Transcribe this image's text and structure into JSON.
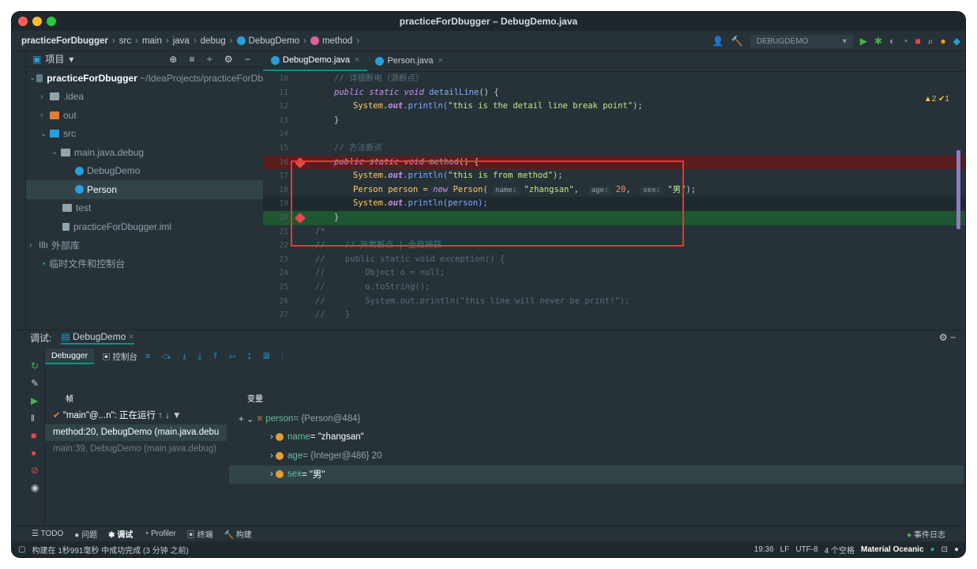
{
  "window_title": "practiceForDbugger – DebugDemo.java",
  "breadcrumb": [
    "practiceForDbugger",
    "src",
    "main",
    "java",
    "debug",
    "DebugDemo",
    "method"
  ],
  "run_config": "DEBUGDEMO",
  "project": {
    "header": "项目",
    "root_name": "practiceForDbugger",
    "root_path": "~/IdeaProjects/practiceForDb",
    "items": [
      {
        "label": ".idea"
      },
      {
        "label": "out"
      },
      {
        "label": "src"
      },
      {
        "label": "main.java.debug"
      },
      {
        "label": "DebugDemo"
      },
      {
        "label": "Person"
      },
      {
        "label": "test"
      },
      {
        "label": "practiceForDbugger.iml"
      },
      {
        "label": "外部库"
      },
      {
        "label": "临时文件和控制台"
      }
    ]
  },
  "editor": {
    "tabs": [
      {
        "label": "DebugDemo.java"
      },
      {
        "label": "Person.java"
      }
    ],
    "inspections": "▲2 ✔1",
    "line_numbers": [
      "10",
      "11",
      "12",
      "13",
      "14",
      "15",
      "16",
      "17",
      "18",
      "19",
      "20",
      "21",
      "22",
      "23",
      "24",
      "25",
      "26",
      "27"
    ],
    "code": {
      "l10": "// 详细断电（源断点）",
      "l11_kw": "public static void ",
      "l11_fn": "detailLine",
      "l11_rest": "() {",
      "l12_a": "System.",
      "l12_b": "out",
      "l12_c": ".println(",
      "l12_s": "\"this is the detail line break point\"",
      "l12_e": ");",
      "l13": "}",
      "l15": "// 方法断点",
      "l16_kw": "public static void ",
      "l16_fn": "method",
      "l16_rest": "() {",
      "l17_a": "System.",
      "l17_b": "out",
      "l17_c": ".println(",
      "l17_s": "\"this is from method\"",
      "l17_e": ");",
      "l18_a": "Person person = ",
      "l18_new": "new ",
      "l18_b": "Person( ",
      "l18_h1": "name:",
      "l18_s1": "\"zhangsan\"",
      "l18_c": ",  ",
      "l18_h2": "age:",
      "l18_n": "20",
      "l18_d": ",  ",
      "l18_h3": "sex:",
      "l18_s2": "\"男\"",
      "l18_e": ");",
      "l19_a": "System.",
      "l19_b": "out",
      "l19_c": ".println(person);",
      "l20": "}",
      "l21": "/*",
      "l22": "//    // 异常断点 | 全局捕获",
      "l23": "//    public static void exception() {",
      "l24": "//        Object o = null;",
      "l25": "//        o.toString();",
      "l26": "//        System.out.println(\"this line will never be print!\");",
      "l27": "//    }"
    }
  },
  "debug": {
    "title": "调试:",
    "config_tab": "DebugDemo",
    "debugger_tab": "Debugger",
    "console_tab": "控制台",
    "frames_header": "帧",
    "vars_header": "变量",
    "thread": "\"main\"@...n\": 正在运行",
    "frames": [
      "method:20, DebugDemo (main.java.debu",
      "main:39, DebugDemo (main.java.debug)"
    ],
    "vars": [
      {
        "name": "person",
        "value": " = {Person@484}"
      },
      {
        "name": "name",
        "value": " = \"zhangsan\""
      },
      {
        "name": "age",
        "value": " = {Integer@486} 20"
      },
      {
        "name": "sex",
        "value": " = \"男\""
      }
    ]
  },
  "bottom_tabs": [
    "TODO",
    "问题",
    "调试",
    "Profiler",
    "终端",
    "构建"
  ],
  "event_log": "事件日志",
  "status": {
    "message": "构建在 1秒991毫秒 中成功完成 (3 分钟 之前)",
    "position": "19:36",
    "line_sep": "LF",
    "encoding": "UTF-8",
    "indent": "4 个空格",
    "theme": "Material Oceanic"
  },
  "colors": {
    "accent": "#009688",
    "breakpoint": "#e5484d",
    "highlight_box": "#e53935"
  }
}
